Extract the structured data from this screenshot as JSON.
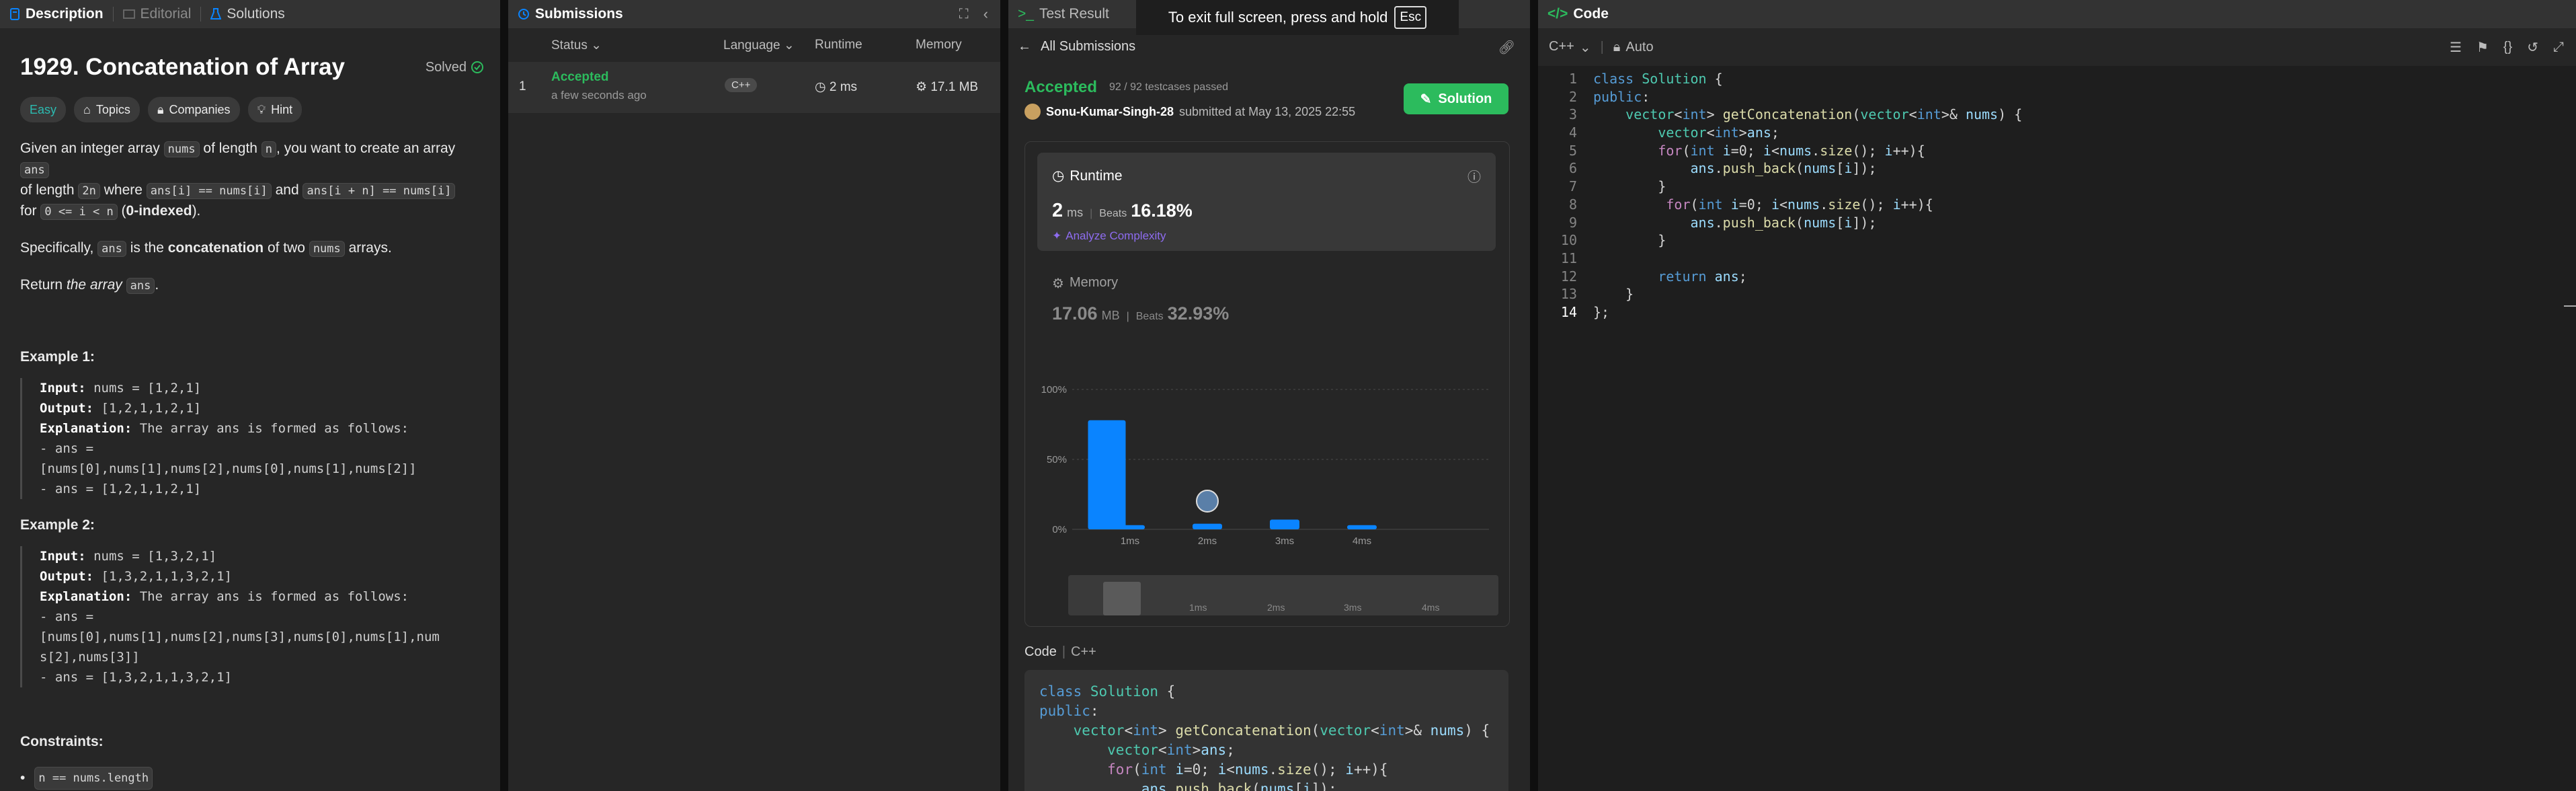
{
  "desc_panel": {
    "tabs": {
      "description": "Description",
      "editorial": "Editorial",
      "solutions": "Solutions"
    },
    "title": "1929. Concatenation of Array",
    "solved": "Solved",
    "tags": {
      "easy": "Easy",
      "topics": "Topics",
      "companies": "Companies",
      "hint": "Hint"
    },
    "p1": {
      "a": "Given an integer array ",
      "nums": "nums",
      "b": " of length ",
      "n": "n",
      "c": ", you want to create an array ",
      "ans": "ans",
      "d": "of length ",
      "twon": "2n",
      "e": " where ",
      "c1": "ans[i] == nums[i]",
      "f": " and ",
      "c2": "ans[i + n] == nums[i]",
      "g": "for ",
      "c3": "0 <= i < n",
      "h": " (",
      "idx": "0-indexed",
      "i": ")."
    },
    "p2": {
      "a": "Specifically, ",
      "ans": "ans",
      "b": " is the ",
      "bold": "concatenation",
      "c": " of two ",
      "nums": "nums",
      "d": " arrays."
    },
    "p3": {
      "a": "Return ",
      "it": "the array",
      "sp": " ",
      "ans": "ans",
      "end": "."
    },
    "ex1": {
      "title": "Example 1:",
      "input_label": "Input:",
      "input": " nums = [1,2,1]",
      "output_label": "Output:",
      "output": " [1,2,1,1,2,1]",
      "expl_label": "Explanation:",
      "expl": " The array ans is formed as follows:",
      "l1": "- ans =",
      "l2": "[nums[0],nums[1],nums[2],nums[0],nums[1],nums[2]]",
      "l3": "- ans = [1,2,1,1,2,1]"
    },
    "ex2": {
      "title": "Example 2:",
      "input_label": "Input:",
      "input": " nums = [1,3,2,1]",
      "output_label": "Output:",
      "output": " [1,3,2,1,1,3,2,1]",
      "expl_label": "Explanation:",
      "expl": " The array ans is formed as follows:",
      "l1": "- ans =",
      "l2": "[nums[0],nums[1],nums[2],nums[3],nums[0],nums[1],num",
      "l3": "s[2],nums[3]]",
      "l4": "- ans = [1,3,2,1,1,3,2,1]"
    },
    "constraints_title": "Constraints:",
    "constraint1": "n == nums.length"
  },
  "subs_panel": {
    "tab": "Submissions",
    "cols": {
      "status": "Status",
      "language": "Language",
      "runtime": "Runtime",
      "memory": "Memory"
    },
    "row": {
      "num": "1",
      "status": "Accepted",
      "time": "a few seconds ago",
      "lang": "C++",
      "runtime": "2 ms",
      "memory": "17.1 MB"
    }
  },
  "result_panel": {
    "tabs": {
      "test": "Test Result"
    },
    "toast": {
      "text": "To exit full screen, press and hold",
      "key": "Esc"
    },
    "back": "All Submissions",
    "accepted": "Accepted",
    "passed": "92 / 92 testcases passed",
    "user": "Sonu-Kumar-Singh-28",
    "submitted": "submitted at May 13, 2025 22:55",
    "solution_btn": "Solution",
    "runtime": {
      "label": "Runtime",
      "value": "2",
      "unit": "ms",
      "beats_label": "Beats",
      "beats": "16.18%",
      "analyze": "Analyze Complexity"
    },
    "memory": {
      "label": "Memory",
      "value": "17.06",
      "unit": "MB",
      "beats_label": "Beats",
      "beats": "32.93%"
    },
    "code_label": "Code",
    "code_lang": "C++",
    "code_lines": [
      "class Solution {",
      "public:",
      "    vector<int> getConcatenation(vector<int>& nums) {",
      "        vector<int>ans;",
      "        for(int i=0; i<nums.size(); i++){",
      "            ans.push_back(nums[i]);"
    ]
  },
  "chart_data": {
    "type": "bar",
    "categories": [
      "1ms",
      "2ms",
      "3ms",
      "4ms"
    ],
    "y_ticks": [
      "100%",
      "50%",
      "0%"
    ],
    "ylim": [
      0,
      100
    ],
    "bars": [
      {
        "x": 0.7,
        "value": 78
      },
      {
        "x": 1.0,
        "value": 3
      },
      {
        "x": 2.0,
        "value": 4
      },
      {
        "x": 3.0,
        "value": 7
      },
      {
        "x": 4.0,
        "value": 3
      }
    ],
    "user_marker_category": "2ms",
    "bar_color": "#0a84ff",
    "minimap_labels": [
      "1ms",
      "2ms",
      "3ms",
      "4ms"
    ]
  },
  "code_panel": {
    "tab": "Code",
    "lang": "C++",
    "mode": "Auto",
    "lines": [
      "class Solution {",
      "public:",
      "    vector<int> getConcatenation(vector<int>& nums) {",
      "        vector<int>ans;",
      "        for(int i=0; i<nums.size(); i++){",
      "            ans.push_back(nums[i]);",
      "        }",
      "         for(int i=0; i<nums.size(); i++){",
      "            ans.push_back(nums[i]);",
      "        }",
      "",
      "        return ans;",
      "    }",
      "};"
    ],
    "current_line": 14
  },
  "colors": {
    "accent": "#0a84ff",
    "green": "#2cbb5d",
    "teal": "#2cbbb1"
  }
}
